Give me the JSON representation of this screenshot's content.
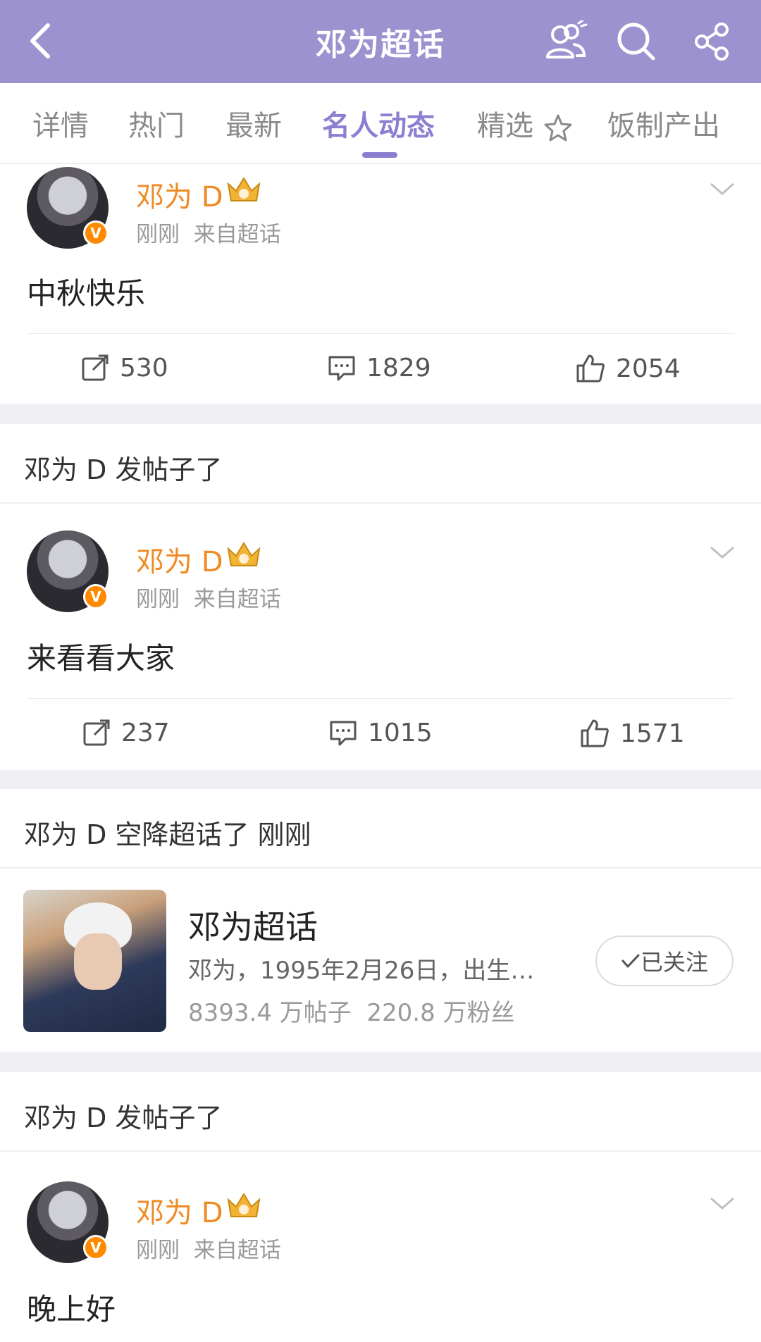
{
  "header": {
    "title": "邓为超话",
    "back_icon": "chevron-left-icon",
    "icons": [
      "user-group-icon",
      "search-icon",
      "share-icon"
    ],
    "bg_color": "#9b92cf"
  },
  "tabs": [
    {
      "label": "详情",
      "active": false
    },
    {
      "label": "热门",
      "active": false
    },
    {
      "label": "最新",
      "active": false
    },
    {
      "label": "名人动态",
      "active": true
    },
    {
      "label": "精选",
      "active": false
    },
    {
      "label": "饭制产出",
      "active": false
    }
  ],
  "posts": [
    {
      "username": "邓为 D",
      "time": "刚刚",
      "source": "来自超话",
      "text": "中秋快乐",
      "reposts": "530",
      "comments": "1829",
      "likes": "2054"
    },
    {
      "username": "邓为 D",
      "time": "刚刚",
      "source": "来自超话",
      "text": "来看看大家",
      "reposts": "237",
      "comments": "1015",
      "likes": "1571"
    },
    {
      "username": "邓为 D",
      "time": "刚刚",
      "source": "来自超话",
      "text": "晚上好"
    }
  ],
  "sections": [
    {
      "text": "邓为 D 发帖子了"
    },
    {
      "text": "邓为 D 空降超话了  刚刚"
    },
    {
      "text": "邓为 D 发帖子了"
    }
  ],
  "topic": {
    "name": "邓为超话",
    "desc": "邓为，1995年2月26日，出生…",
    "posts": "8393.4 万帖子",
    "fans": "220.8 万粉丝",
    "follow_label": "已关注"
  },
  "colors": {
    "accent": "#8a7fd0",
    "username": "#f08a24",
    "verified": "#ff8a00"
  }
}
